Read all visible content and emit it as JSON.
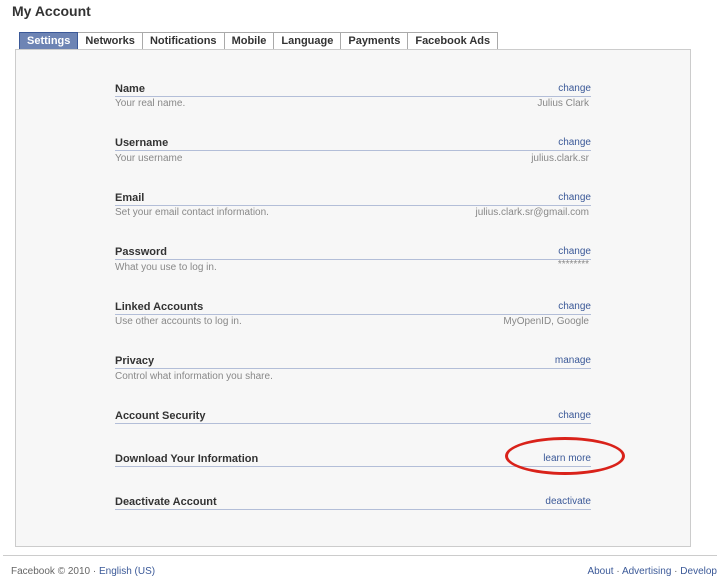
{
  "page_title": "My Account",
  "tabs": [
    {
      "label": "Settings"
    },
    {
      "label": "Networks"
    },
    {
      "label": "Notifications"
    },
    {
      "label": "Mobile"
    },
    {
      "label": "Language"
    },
    {
      "label": "Payments"
    },
    {
      "label": "Facebook Ads"
    }
  ],
  "settings": [
    {
      "label": "Name",
      "action": "change",
      "description": "Your real name.",
      "value": "Julius Clark"
    },
    {
      "label": "Username",
      "action": "change",
      "description": "Your username",
      "value": "julius.clark.sr"
    },
    {
      "label": "Email",
      "action": "change",
      "description": "Set your email contact information.",
      "value": "julius.clark.sr@gmail.com"
    },
    {
      "label": "Password",
      "action": "change",
      "description": "What you use to log in.",
      "value": "********"
    },
    {
      "label": "Linked Accounts",
      "action": "change",
      "description": "Use other accounts to log in.",
      "value": "MyOpenID, Google"
    },
    {
      "label": "Privacy",
      "action": "manage",
      "description": "Control what information you share.",
      "value": ""
    },
    {
      "label": "Account Security",
      "action": "change",
      "description": "",
      "value": ""
    },
    {
      "label": "Download Your Information",
      "action": "learn more",
      "description": "",
      "value": ""
    },
    {
      "label": "Deactivate Account",
      "action": "deactivate",
      "description": "",
      "value": ""
    }
  ],
  "footer": {
    "copyright": "Facebook © 2010 · ",
    "language": "English (US)",
    "links": [
      "About",
      "Advertising",
      "Develop"
    ],
    "separator": " · "
  },
  "colors": {
    "link": "#3b5998",
    "active_tab": "#6d84b4",
    "annotation": "#d9221a"
  }
}
